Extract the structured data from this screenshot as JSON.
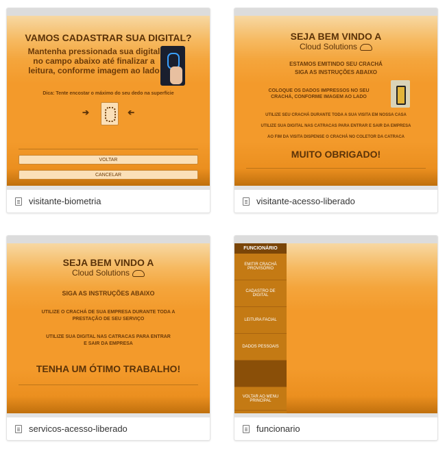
{
  "cards": [
    {
      "name": "visitante-biometria",
      "title": "VAMOS CADASTRAR SUA DIGITAL?",
      "body": "Mantenha pressionada sua digital no campo abaixo até finalizar a leitura, conforme imagem ao lado",
      "tip": "Dica: Tente encostar o máximo do seu dedo na superfície",
      "buttons": [
        "VOLTAR",
        "CANCELAR"
      ]
    },
    {
      "name": "visitante-acesso-liberado",
      "title": "SEJA BEM VINDO A",
      "subtitle": "Cloud Solutions",
      "lines": [
        "ESTAMOS EMITINDO SEU CRACHÁ",
        "SIGA AS INSTRUÇÕES ABAIXO",
        "COLOQUE OS DADOS IMPRESSOS NO SEU",
        "CRACHÁ, CONFORME IMAGEM AO LADO",
        "UTILIZE SEU CRACHÁ DURANTE TODA A SUA VISITA EM NOSSA CASA",
        "UTILIZE SUA DIGITAL NAS CATRACAS PARA ENTRAR E SAIR DA EMPRESA",
        "AO FIM DA VISITA DISPENSE O CRACHÁ NO COLETOR DA CATRACA"
      ],
      "closing": "MUITO OBRIGADO!"
    },
    {
      "name": "servicos-acesso-liberado",
      "title": "SEJA BEM VINDO A",
      "subtitle": "Cloud Solutions",
      "lines": [
        "SIGA AS INSTRUÇÕES ABAIXO",
        "UTILIZE O CRACHÁ DE SUA EMPRESA DURANTE TODA A",
        "PRESTAÇÃO DE SEU SERVIÇO",
        "UTILIZE SUA DIGITAL NAS CATRACAS PARA ENTRAR",
        "E SAIR DA EMPRESA"
      ],
      "closing": "TENHA UM ÓTIMO TRABALHO!"
    },
    {
      "name": "funcionario",
      "menu_title": "FUNCIONÁRIO",
      "menu_items": [
        "EMITIR CRACHÁ PROVISÓRIO",
        "CADASTRO DE DIGITAL",
        "LEITURA FACIAL",
        "DADOS PESSOAIS",
        "",
        "VOLTAR AO MENU PRINCIPAL"
      ]
    }
  ]
}
